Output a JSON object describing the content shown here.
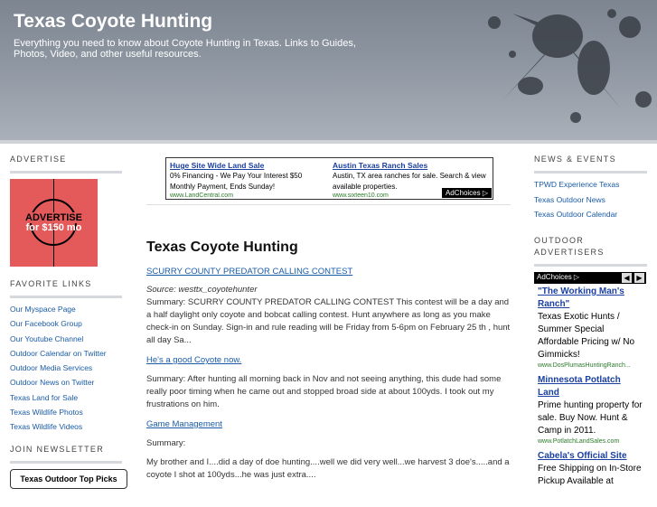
{
  "header": {
    "title": "Texas Coyote Hunting",
    "description": "Everything you need to know about Coyote Hunting in Texas. Links to Guides, Photos, Video, and other useful resources."
  },
  "left": {
    "advertise_heading": "ADVERTISE",
    "ad_line1": "ADVERTISE",
    "ad_line2": "for $150 mo",
    "favorite_heading": "FAVORITE LINKS",
    "links": [
      "Our Myspace Page",
      "Our Facebook Group",
      "Our Youtube Channel",
      "Outdoor Calendar on Twitter",
      "Outdoor Media Services",
      "Outdoor News on Twitter",
      "Texas Land for Sale",
      "Texas Wildlife Photos",
      "Texas Wildlife Videos"
    ],
    "join_heading": "JOIN NEWSLETTER",
    "join_box": "Texas Outdoor Top Picks"
  },
  "top_ad": {
    "ad1_title": "Huge Site Wide Land Sale",
    "ad1_text": "0% Financing - We Pay Your Interest $50 Monthly Payment, Ends Sunday!",
    "ad1_url": "www.LandCentral.com",
    "ad2_title": "Austin Texas Ranch Sales",
    "ad2_text": "Austin, TX area ranches for sale. Search & view available properties.",
    "ad2_url": "www.sixteen10.com",
    "adchoices": "AdChoices ▷"
  },
  "main": {
    "post_title": "Texas Coyote Hunting",
    "entry1_link": "SCURRY COUNTY PREDATOR CALLING CONTEST",
    "entry1_source": "Source: westtx_coyotehunter",
    "entry1_summary": "Summary: SCURRY COUNTY PREDATOR CALLING CONTEST   This contest will be a day and a half daylight only coyote and bobcat calling contest.   Hunt anywhere as long as you make check-in on Sunday. Sign-in and rule reading will be Friday from 5-6pm on February 25 th , hunt all day Sa...",
    "entry2_link": "He's a good Coyote now.",
    "entry2_summary": "Summary: After hunting all morning back in Nov and not seeing anything, this dude had some really poor timing when he came out and stopped broad side at about 100yds.  I took out my frustrations on him.",
    "entry3_link": "Game Management",
    "entry3_summary": "Summary:",
    "entry3_text": "My brother and I....did a day of doe hunting....well we did very well...we harvest 3 doe's.....and a coyote I shot at 100yds...he was just extra...."
  },
  "right": {
    "news_heading": "NEWS & EVENTS",
    "news_links": [
      "TPWD Experience Texas",
      "Texas Outdoor News",
      "Texas Outdoor Calendar"
    ],
    "adv_heading": "OUTDOOR ADVERTISERS",
    "adchoices": "AdChoices ▷",
    "prev": "◀",
    "next": "▶",
    "ads": [
      {
        "title": "\"The Working Man's Ranch\"",
        "text": "Texas Exotic Hunts / Summer Special Affordable Pricing w/ No Gimmicks!",
        "url": "www.DosPlumasHuntingRanch..."
      },
      {
        "title": "Minnesota Potlatch Land",
        "text": "Prime hunting property for sale. Buy Now. Hunt & Camp in 2011.",
        "url": "www.PotlatchLandSales.com"
      },
      {
        "title": "Cabela's Official Site",
        "text": "Free Shipping on In-Store Pickup Available at",
        "url": ""
      }
    ]
  },
  "colors": {
    "link": "#1a5ba6",
    "header_gray": "#8e96a1",
    "ad_red": "#e45a5a"
  }
}
